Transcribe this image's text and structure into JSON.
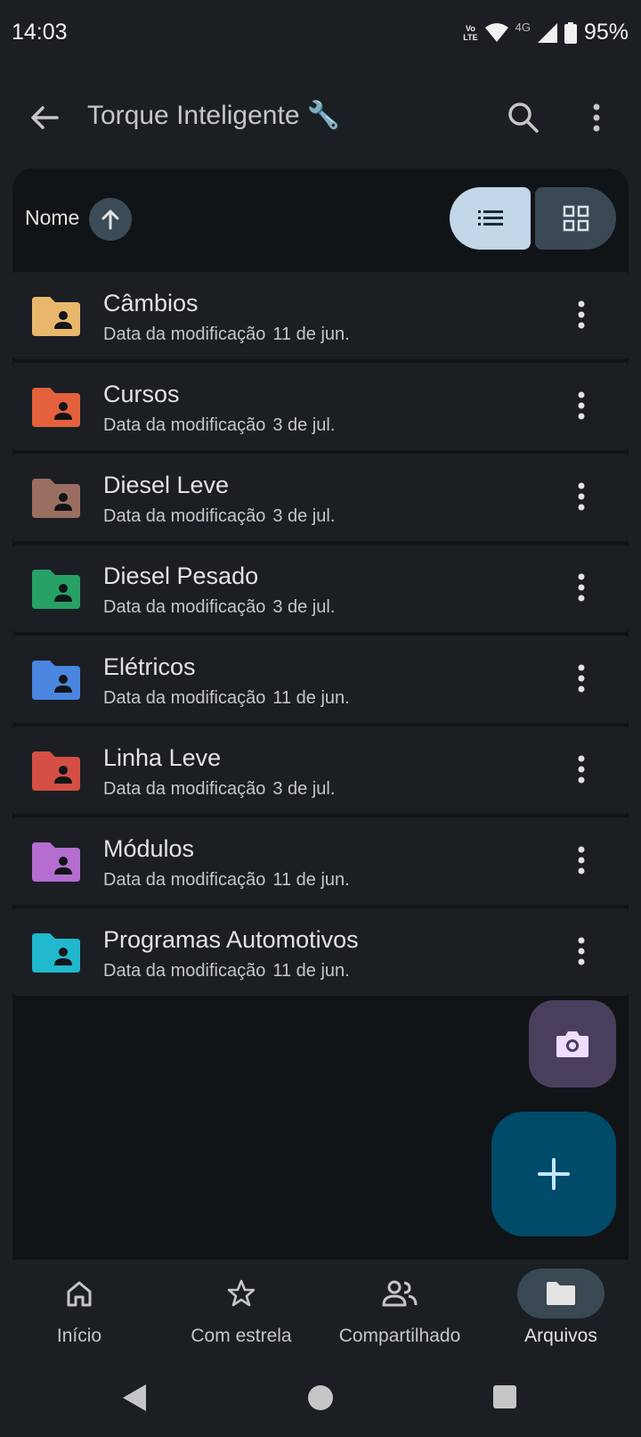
{
  "status": {
    "time": "14:03",
    "volte_top": "Vo",
    "volte_bottom": "LTE",
    "network": "4G",
    "battery": "95%"
  },
  "app_bar": {
    "title": "Torque Inteligente 🔧"
  },
  "sort": {
    "label": "Nome",
    "direction": "ascending"
  },
  "view": {
    "selected": "list"
  },
  "files": [
    {
      "name": "Câmbios",
      "modified_label": "Data da modificação",
      "modified": "11 de jun.",
      "color": "#e8b76c"
    },
    {
      "name": "Cursos",
      "modified_label": "Data da modificação",
      "modified": "3 de jul.",
      "color": "#e3623d"
    },
    {
      "name": "Diesel Leve",
      "modified_label": "Data da modificação",
      "modified": "3 de jul.",
      "color": "#9a6f61"
    },
    {
      "name": "Diesel Pesado",
      "modified_label": "Data da modificação",
      "modified": "3 de jul.",
      "color": "#27a165"
    },
    {
      "name": "Elétricos",
      "modified_label": "Data da modificação",
      "modified": "11 de jun.",
      "color": "#4a86e0"
    },
    {
      "name": "Linha Leve",
      "modified_label": "Data da modificação",
      "modified": "3 de jul.",
      "color": "#d44f45"
    },
    {
      "name": "Módulos",
      "modified_label": "Data da modificação",
      "modified": "11 de jun.",
      "color": "#b56dd0"
    },
    {
      "name": "Programas Automotivos",
      "modified_label": "Data da modificação",
      "modified": "11 de jun.",
      "color": "#1fb8cc"
    }
  ],
  "nav": [
    {
      "label": "Início",
      "icon": "home-icon",
      "active": false
    },
    {
      "label": "Com estrela",
      "icon": "star-icon",
      "active": false
    },
    {
      "label": "Compartilhado",
      "icon": "people-icon",
      "active": false
    },
    {
      "label": "Arquivos",
      "icon": "folder-icon",
      "active": true
    }
  ]
}
